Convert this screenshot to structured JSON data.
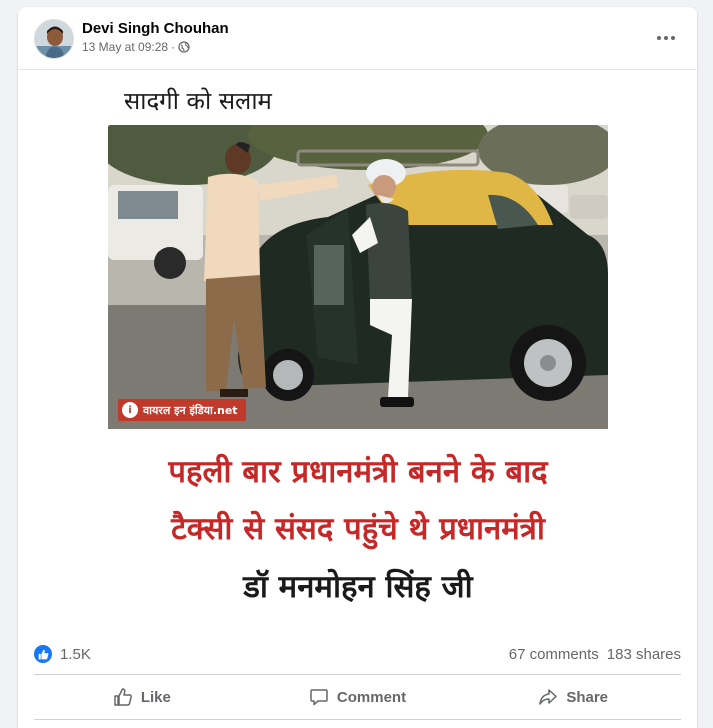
{
  "post": {
    "author": "Devi Singh Chouhan",
    "timestamp": "13 May at 09:28",
    "separator": "·",
    "privacy_icon": "globe-icon",
    "more_icon": "more-horizontal-icon"
  },
  "image": {
    "top_text": "सादगी को सलाम",
    "watermark": "वायरल इन इंडिया.net",
    "headline_line1": "पहली बार प्रधानमंत्री बनने के बाद",
    "headline_line2": "टैक्सी से संसद पहुंचे थे प्रधानमंत्री",
    "headline_line3": "डॉ मनमोहन सिंह जी"
  },
  "stats": {
    "reactions": "1.5K",
    "comments": "67 comments",
    "shares": "183 shares"
  },
  "actions": {
    "like_label": "Like",
    "comment_label": "Comment",
    "share_label": "Share"
  },
  "colors": {
    "brand_blue": "#1877f2",
    "headline_red": "#c62828",
    "taxi_yellow": "#e0b744",
    "taxi_body": "#1e2a22"
  }
}
